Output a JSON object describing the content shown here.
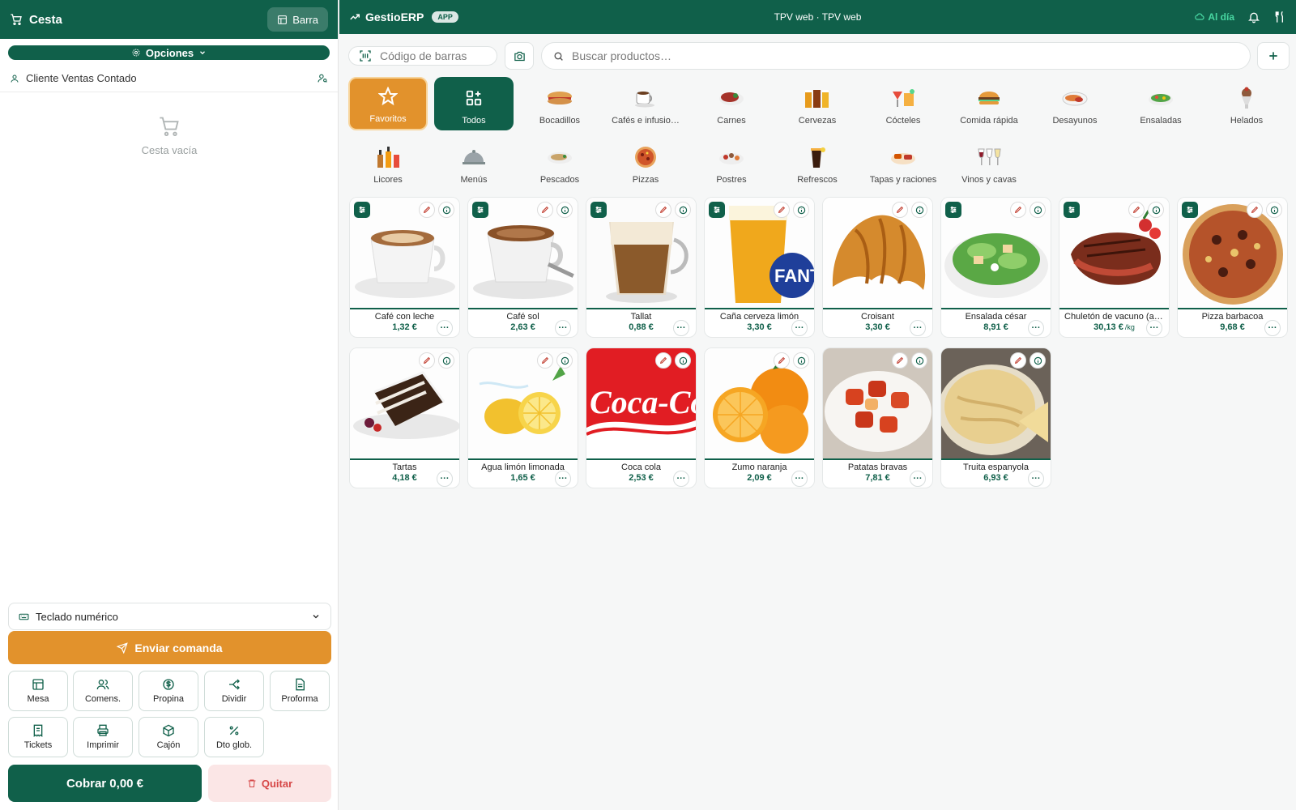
{
  "sidebar": {
    "title": "Cesta",
    "barra_label": "Barra",
    "opciones_label": "Opciones",
    "client_name": "Cliente Ventas Contado",
    "empty_label": "Cesta vacía",
    "keypad_label": "Teclado numérico",
    "send_label": "Enviar comanda",
    "actions": [
      "Mesa",
      "Comens.",
      "Propina",
      "Dividir",
      "Proforma",
      "Tickets",
      "Imprimir",
      "Cajón",
      "Dto glob."
    ],
    "charge_label": "Cobrar 0,00 €",
    "remove_label": "Quitar"
  },
  "topbar": {
    "brand": "GestioERP",
    "app_badge": "APP",
    "center_title": "TPV web · TPV web",
    "status": "Al día"
  },
  "search": {
    "barcode_placeholder": "Código de barras",
    "search_placeholder": "Buscar productos…"
  },
  "categories": [
    "Favoritos",
    "Todos",
    "Bocadillos",
    "Cafés e infusio…",
    "Carnes",
    "Cervezas",
    "Cócteles",
    "Comida rápida",
    "Desayunos",
    "Ensaladas",
    "Helados",
    "Licores",
    "Menús",
    "Pescados",
    "Pizzas",
    "Postres",
    "Refrescos",
    "Tapas y raciones",
    "Vinos y cavas"
  ],
  "products": [
    {
      "name": "Café con leche",
      "price": "1,32 €"
    },
    {
      "name": "Café sol",
      "price": "2,63 €"
    },
    {
      "name": "Tallat",
      "price": "0,88 €"
    },
    {
      "name": "Caña cerveza limón",
      "price": "3,30 €"
    },
    {
      "name": "Croisant",
      "price": "3,30 €"
    },
    {
      "name": "Ensalada césar",
      "price": "8,91 €"
    },
    {
      "name": "Chuletón de vacuno (al …",
      "price": "30,13 €",
      "unit": "/kg"
    },
    {
      "name": "Pizza barbacoa",
      "price": "9,68 €"
    },
    {
      "name": "Tartas",
      "price": "4,18 €"
    },
    {
      "name": "Agua limón limonada",
      "price": "1,65 €"
    },
    {
      "name": "Coca cola",
      "price": "2,53 €"
    },
    {
      "name": "Zumo naranja",
      "price": "2,09 €"
    },
    {
      "name": "Patatas bravas",
      "price": "7,81 €"
    },
    {
      "name": "Truita espanyola",
      "price": "6,93 €"
    }
  ],
  "colors": {
    "primary": "#10604a",
    "accent": "#e2922c",
    "danger": "#d64545"
  }
}
